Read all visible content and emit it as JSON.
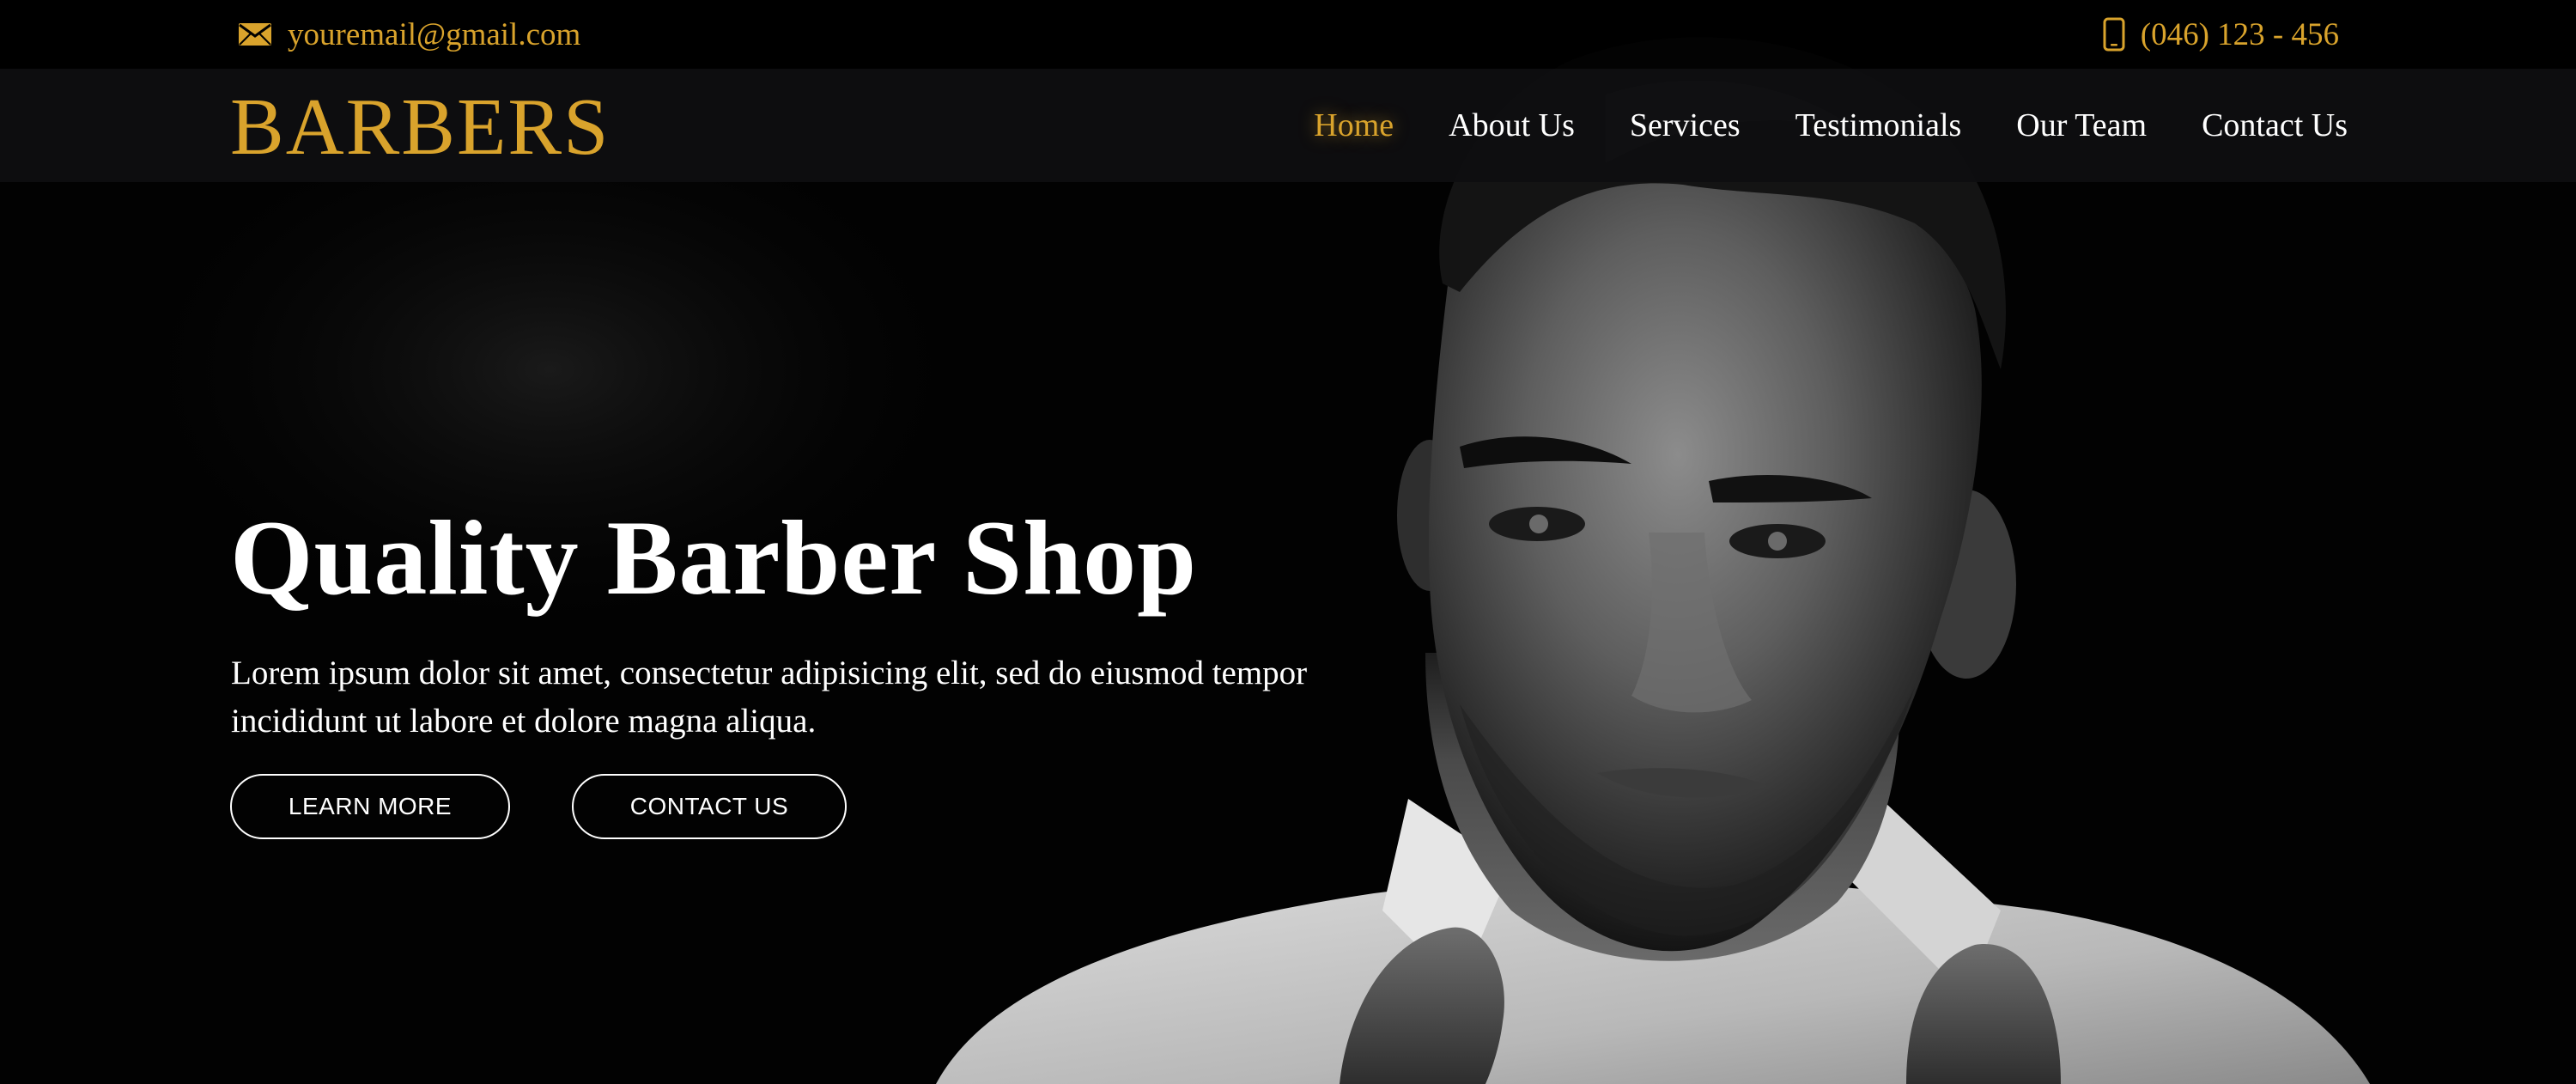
{
  "colors": {
    "accent": "#d9a32c",
    "nav_text": "#ffffff",
    "topbar_bg": "#000000",
    "navbar_bg": "#0e0e10",
    "hero_bg": "#020202"
  },
  "topbar": {
    "email": {
      "icon": "envelope-icon",
      "text": "youremail@gmail.com"
    },
    "phone": {
      "icon": "mobile-phone-icon",
      "text": "(046) 123 - 456"
    }
  },
  "header": {
    "brand": "BARBERS",
    "nav": [
      {
        "label": "Home",
        "active": true
      },
      {
        "label": "About Us",
        "active": false
      },
      {
        "label": "Services",
        "active": false
      },
      {
        "label": "Testimonials",
        "active": false
      },
      {
        "label": "Our Team",
        "active": false
      },
      {
        "label": "Contact Us",
        "active": false
      }
    ]
  },
  "hero": {
    "title": "Quality Barber Shop",
    "description": "Lorem ipsum dolor sit amet, consectetur adipisicing elit, sed do eiusmod tempor incididunt ut labore et dolore magna aliqua.",
    "buttons": {
      "learn_more": "LEARN MORE",
      "contact_us": "CONTACT US"
    }
  }
}
